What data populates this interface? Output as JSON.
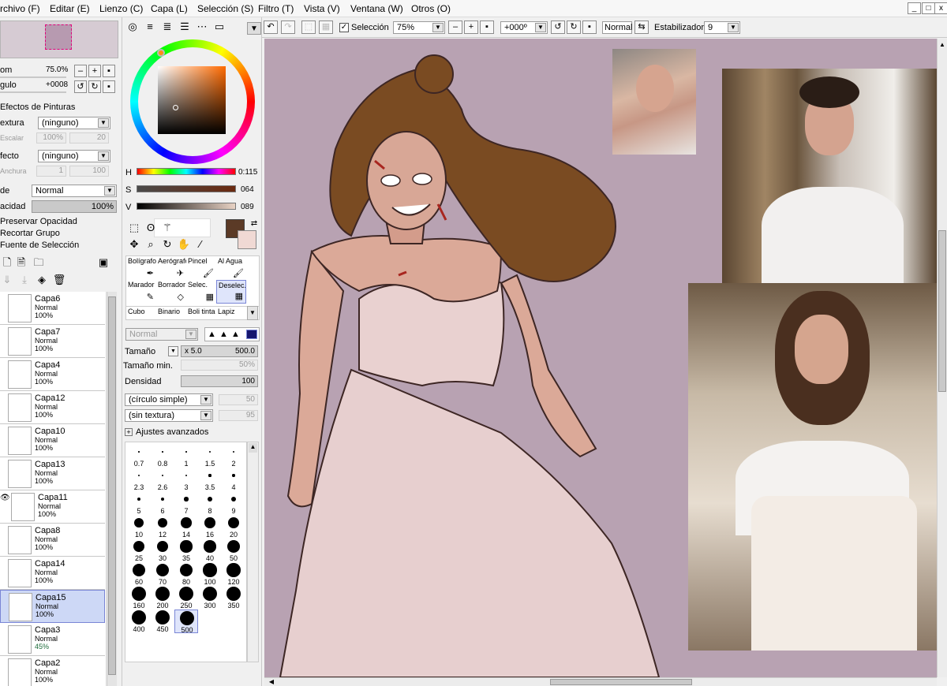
{
  "menu": [
    "rchivo (F)",
    "Editar (E)",
    "Lienzo (C)",
    "Capa (L)",
    "Selección (S)",
    "Filtro (T)",
    "Vista (V)",
    "Ventana (W)",
    "Otros (O)"
  ],
  "window_buttons": [
    "_",
    "□",
    "x"
  ],
  "navigator": {
    "zoom_label": "om",
    "zoom_value": "75.0%",
    "angle_label": "gulo",
    "angle_value": "+0008"
  },
  "effects": {
    "section_title": "Efectos de Pinturas",
    "texture_label": "extura",
    "texture_value": "(ninguno)",
    "scale_label": "Escalar",
    "scale_value": "100%",
    "scale_value2": "20",
    "effect_label": "fecto",
    "effect_value": "(ninguno)",
    "width_label": "Anchura",
    "width_value": "1",
    "width_value2": "100"
  },
  "layer_props": {
    "mode_label": "de",
    "mode_value": "Normal",
    "opacity_label": "acidad",
    "opacity_value": "100%",
    "checks": [
      "Preservar Opacidad",
      "Recortar Grupo",
      "Fuente de Selección"
    ]
  },
  "layers": [
    {
      "name": "Capa6",
      "mode": "Normal",
      "opacity": "100%"
    },
    {
      "name": "Capa7",
      "mode": "Normal",
      "opacity": "100%"
    },
    {
      "name": "Capa4",
      "mode": "Normal",
      "opacity": "100%"
    },
    {
      "name": "Capa12",
      "mode": "Normal",
      "opacity": "100%"
    },
    {
      "name": "Capa10",
      "mode": "Normal",
      "opacity": "100%"
    },
    {
      "name": "Capa13",
      "mode": "Normal",
      "opacity": "100%"
    },
    {
      "name": "Capa11",
      "mode": "Normal",
      "opacity": "100%"
    },
    {
      "name": "Capa8",
      "mode": "Normal",
      "opacity": "100%"
    },
    {
      "name": "Capa14",
      "mode": "Normal",
      "opacity": "100%"
    },
    {
      "name": "Capa15",
      "mode": "Normal",
      "opacity": "100%"
    },
    {
      "name": "Capa3",
      "mode": "Normal",
      "opacity": "45%"
    },
    {
      "name": "Capa2",
      "mode": "Normal",
      "opacity": "100%"
    }
  ],
  "color": {
    "h_label": "H",
    "h_value": "0:115",
    "s_label": "S",
    "s_value": "064",
    "v_label": "V",
    "v_value": "089",
    "main_color": "#5b3a26",
    "secondary_color": "#f0d9d4"
  },
  "tools": [
    {
      "label": "Bolígrafo",
      "glyph": "✒"
    },
    {
      "label": "Aerógrafo",
      "glyph": "✈"
    },
    {
      "label": "Pincel",
      "glyph": "🖌"
    },
    {
      "label": "Al Agua",
      "glyph": "🖌"
    },
    {
      "label": "Marador",
      "glyph": "✎"
    },
    {
      "label": "Borrador",
      "glyph": "◇"
    },
    {
      "label": "Selec.",
      "glyph": "▦"
    },
    {
      "label": "Deselec.",
      "glyph": "▦"
    },
    {
      "label": "Cubo",
      "glyph": "⛀"
    },
    {
      "label": "Binario",
      "glyph": "✎"
    },
    {
      "label": "Boli tinta",
      "glyph": "✒"
    },
    {
      "label": "Lapiz",
      "glyph": "✏"
    }
  ],
  "brush": {
    "mode_value": "Normal",
    "size_label": "Tamaño",
    "size_mult": "x 5.0",
    "size_value": "500.0",
    "min_size_label": "Tamaño min.",
    "min_size_value": "50%",
    "density_label": "Densidad",
    "density_value": "100",
    "shape_value": "(círculo simple)",
    "shape_num": "50",
    "texture_value": "(sin textura)",
    "texture_num": "95",
    "advanced_label": "Ajustes avanzados",
    "sizes": [
      "0.7",
      "0.8",
      "1",
      "1.5",
      "2",
      "2.3",
      "2.6",
      "3",
      "3.5",
      "4",
      "5",
      "6",
      "7",
      "8",
      "9",
      "10",
      "12",
      "14",
      "16",
      "20",
      "25",
      "30",
      "35",
      "40",
      "50",
      "60",
      "70",
      "80",
      "100",
      "120",
      "160",
      "200",
      "250",
      "300",
      "350",
      "400",
      "450",
      "500"
    ],
    "selected_size": "500"
  },
  "toolbar": {
    "selection_label": "Selección",
    "zoom_value": "75%",
    "angle_value": "+000º",
    "blend_value": "Normal",
    "stabilizer_label": "Estabilizador",
    "stabilizer_value": "9"
  }
}
